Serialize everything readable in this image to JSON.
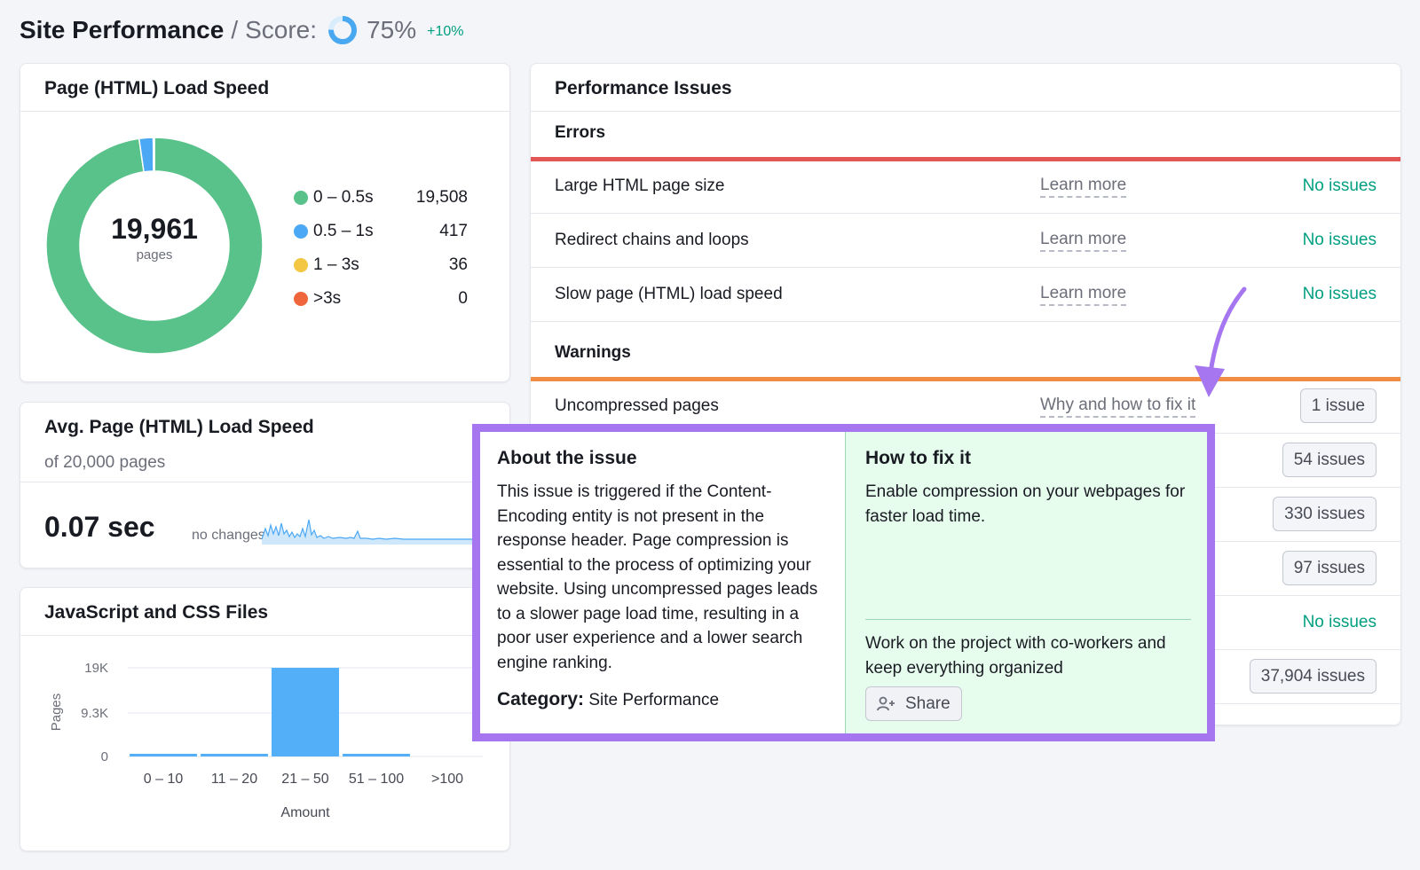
{
  "header": {
    "title": "Site Performance",
    "separator": "/",
    "score_label": "Score:",
    "score": "75%",
    "score_fraction": 0.75,
    "delta": "+10%",
    "ring_color": "#4aa8f0",
    "delta_color": "#009f81"
  },
  "load_speed": {
    "title": "Page (HTML) Load Speed",
    "total": "19,961",
    "unit": "pages",
    "legend": [
      {
        "label": "0 – 0.5s",
        "value": "19,508",
        "count": 19508,
        "color": "#59c28a"
      },
      {
        "label": "0.5 – 1s",
        "value": "417",
        "count": 417,
        "color": "#4ba8f5"
      },
      {
        "label": "1 – 3s",
        "value": "36",
        "count": 36,
        "color": "#f3c643"
      },
      {
        "label": ">3s",
        "value": "0",
        "count": 0,
        "color": "#f0663c"
      }
    ]
  },
  "avg_speed": {
    "title": "Avg. Page (HTML) Load Speed",
    "subtitle": "of 20,000 pages",
    "value": "0.07 sec",
    "change": "no changes"
  },
  "js_css": {
    "title": "JavaScript and CSS Files"
  },
  "chart_data": {
    "type": "bar",
    "title": "JavaScript and CSS Files",
    "categories": [
      "0 – 10",
      "11 – 20",
      "21 – 50",
      "51 – 100",
      ">100"
    ],
    "values": [
      200,
      200,
      19000,
      200,
      0
    ],
    "ylabel": "Pages",
    "xlabel": "Amount",
    "yticks": [
      "19K",
      "9.3K",
      "0"
    ],
    "ytick_values": [
      19000,
      9300,
      0
    ],
    "ylim": [
      0,
      19000
    ],
    "bar_color": "#53aff7",
    "grid": true
  },
  "issues": {
    "title": "Performance Issues",
    "errors_title": "Errors",
    "errors_color": "#e35656",
    "warnings_title": "Warnings",
    "warnings_color": "#f08c44",
    "errors": [
      {
        "name": "Large HTML page size",
        "link": "Learn more",
        "status": "No issues"
      },
      {
        "name": "Redirect chains and loops",
        "link": "Learn more",
        "status": "No issues"
      },
      {
        "name": "Slow page (HTML) load speed",
        "link": "Learn more",
        "status": "No issues"
      }
    ],
    "warnings": [
      {
        "name": "Uncompressed pages",
        "link": "Why and how to fix it",
        "badge": "1 issue"
      },
      {
        "badge": "54 issues"
      },
      {
        "badge": "330 issues"
      },
      {
        "badge": "97 issues"
      },
      {
        "status": "No issues"
      },
      {
        "badge": "37,904 issues"
      }
    ]
  },
  "popup": {
    "about_title": "About the issue",
    "about_text": "This issue is triggered if the Content-Encoding entity is not present in the response header. Page compression is essential to the process of optimizing your website. Using uncompressed pages leads to a slower page load time, resulting in a poor user experience and a lower search engine ranking.",
    "category_label": "Category:",
    "category_value": "Site Performance",
    "fix_title": "How to fix it",
    "fix_text": "Enable compression on your webpages for faster load time.",
    "cowork_text": "Work on the project with co-workers and keep everything organized",
    "share_label": "Share",
    "highlight_color": "#a576f0"
  }
}
